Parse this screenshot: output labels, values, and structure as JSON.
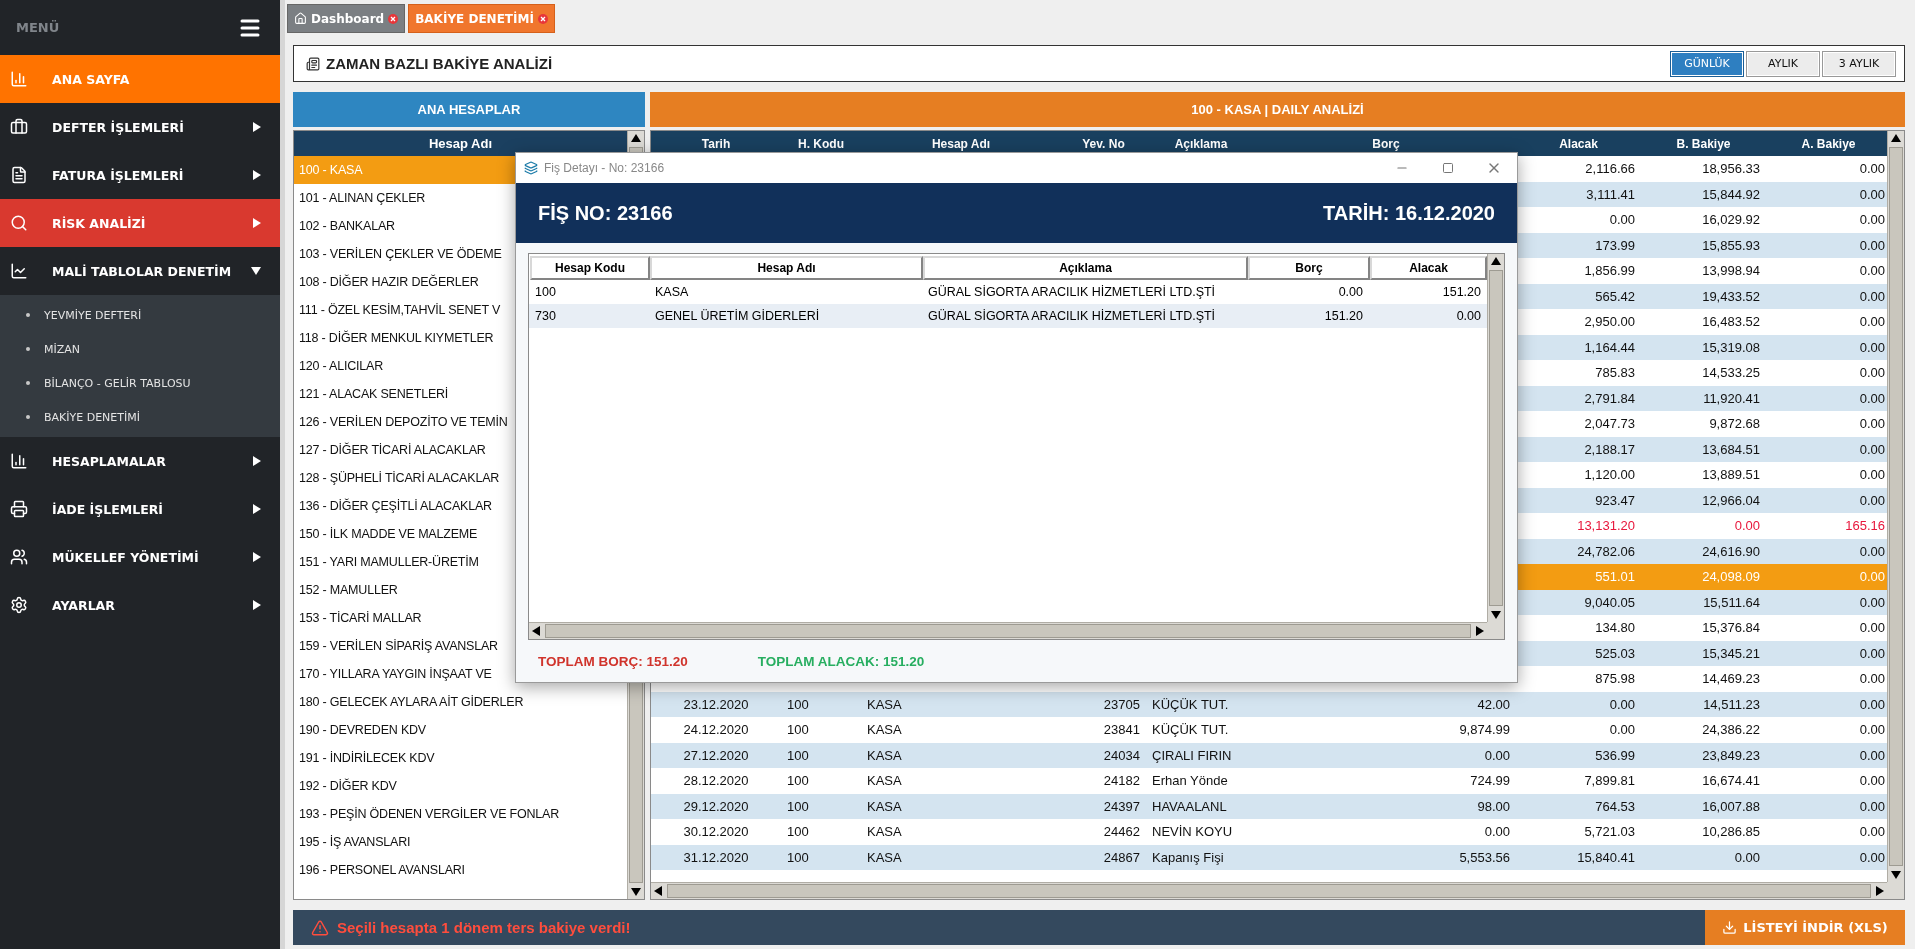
{
  "sidebar": {
    "title": "MENÜ",
    "items": [
      {
        "label": "ANA SAYFA",
        "color": "#ff7300"
      },
      {
        "label": "DEFTER İŞLEMLERİ",
        "color": "#212428",
        "expanded": false
      },
      {
        "label": "FATURA İŞLEMLERİ",
        "color": "#212428",
        "expanded": false
      },
      {
        "label": "RİSK ANALİZİ",
        "color": "#d9392f",
        "expanded": false
      },
      {
        "label": "MALİ TABLOLAR DENETİM",
        "color": "#212428",
        "expanded": true,
        "children": [
          "YEVMİYE DEFTERİ",
          "MİZAN",
          "BİLANÇO - GELİR TABLOSU",
          "BAKİYE DENETİMİ"
        ]
      },
      {
        "label": "HESAPLAMALAR",
        "color": "#212428",
        "expanded": false
      },
      {
        "label": "İADE İŞLEMLERİ",
        "color": "#212428",
        "expanded": false
      },
      {
        "label": "MÜKELLEF YÖNETİMİ",
        "color": "#212428",
        "expanded": false
      },
      {
        "label": "AYARLAR",
        "color": "#212428",
        "expanded": false
      }
    ]
  },
  "tabs": [
    {
      "label": "Dashboard",
      "selected": false
    },
    {
      "label": "BAKİYE DENETİMİ",
      "selected": true
    }
  ],
  "panel": {
    "title": "ZAMAN BAZLI BAKİYE ANALİZİ",
    "periods": [
      {
        "label": "GÜNLÜK",
        "selected": true
      },
      {
        "label": "AYLIK",
        "selected": false
      },
      {
        "label": "3 AYLIK",
        "selected": false
      }
    ]
  },
  "accounts": {
    "title": "ANA HESAPLAR",
    "column": "Hesap Adı",
    "items": [
      {
        "label": "100 - KASA",
        "selected": true
      },
      {
        "label": "101 - ALINAN ÇEKLER",
        "selected": false
      },
      {
        "label": "102 - BANKALAR",
        "selected": false
      },
      {
        "label": "103 - VERİLEN ÇEKLER VE ÖDEME",
        "selected": false
      },
      {
        "label": "108 - DİĞER HAZIR DEĞERLER",
        "selected": false
      },
      {
        "label": "111 - ÖZEL KESİM,TAHVİL SENET V",
        "selected": false
      },
      {
        "label": "118 - DİĞER MENKUL KIYMETLER",
        "selected": false
      },
      {
        "label": "120 - ALICILAR",
        "selected": false
      },
      {
        "label": "121 - ALACAK SENETLERİ",
        "selected": false
      },
      {
        "label": "126 - VERİLEN DEPOZİTO VE TEMİN",
        "selected": false
      },
      {
        "label": "127 - DİĞER TİCARİ ALACAKLAR",
        "selected": false
      },
      {
        "label": "128 - ŞÜPHELİ TİCARİ ALACAKLAR",
        "selected": false
      },
      {
        "label": "136 - DİĞER ÇEŞİTLİ ALACAKLAR",
        "selected": false
      },
      {
        "label": "150 - İLK MADDE VE MALZEME",
        "selected": false
      },
      {
        "label": "151 - YARI MAMULLER-ÜRETİM",
        "selected": false
      },
      {
        "label": "152 - MAMULLER",
        "selected": false
      },
      {
        "label": "153 - TİCARİ MALLAR",
        "selected": false
      },
      {
        "label": "159 - VERİLEN SİPARİŞ AVANSLAR",
        "selected": false
      },
      {
        "label": "170 - YILLARA YAYGIN İNŞAAT VE",
        "selected": false
      },
      {
        "label": "180 - GELECEK AYLARA AİT GİDERLER",
        "selected": false
      },
      {
        "label": "190 - DEVREDEN KDV",
        "selected": false
      },
      {
        "label": "191 - İNDİRİLECEK KDV",
        "selected": false
      },
      {
        "label": "192 - DİĞER KDV",
        "selected": false
      },
      {
        "label": "193 - PEŞİN ÖDENEN VERGİLER VE FONLAR",
        "selected": false
      },
      {
        "label": "195 - İŞ AVANSLARI",
        "selected": false
      },
      {
        "label": "196 - PERSONEL AVANSLARI",
        "selected": false
      }
    ]
  },
  "analysis": {
    "title": "100 - KASA | DAILY ANALİZİ",
    "columns": [
      "Tarih",
      "H. Kodu",
      "Hesap Adı",
      "Yev. No",
      "Açıklama",
      "Borç",
      "Alacak",
      "B. Bakiye",
      "A. Bakiye"
    ],
    "rows": [
      {
        "credit": "2,116.66",
        "debit_balance": "18,956.33",
        "credit_balance": "0.00",
        "selected": false,
        "alert": false
      },
      {
        "credit": "3,111.41",
        "debit_balance": "15,844.92",
        "credit_balance": "0.00",
        "selected": false,
        "alert": false
      },
      {
        "credit": "0.00",
        "debit_balance": "16,029.92",
        "credit_balance": "0.00",
        "selected": false,
        "alert": false
      },
      {
        "credit": "173.99",
        "debit_balance": "15,855.93",
        "credit_balance": "0.00",
        "selected": false,
        "alert": false
      },
      {
        "credit": "1,856.99",
        "debit_balance": "13,998.94",
        "credit_balance": "0.00",
        "selected": false,
        "alert": false
      },
      {
        "credit": "565.42",
        "debit_balance": "19,433.52",
        "credit_balance": "0.00",
        "selected": false,
        "alert": false
      },
      {
        "credit": "2,950.00",
        "debit_balance": "16,483.52",
        "credit_balance": "0.00",
        "selected": false,
        "alert": false
      },
      {
        "credit": "1,164.44",
        "debit_balance": "15,319.08",
        "credit_balance": "0.00",
        "selected": false,
        "alert": false
      },
      {
        "credit": "785.83",
        "debit_balance": "14,533.25",
        "credit_balance": "0.00",
        "selected": false,
        "alert": false
      },
      {
        "credit": "2,791.84",
        "debit_balance": "11,920.41",
        "credit_balance": "0.00",
        "selected": false,
        "alert": false
      },
      {
        "credit": "2,047.73",
        "debit_balance": "9,872.68",
        "credit_balance": "0.00",
        "selected": false,
        "alert": false
      },
      {
        "credit": "2,188.17",
        "debit_balance": "13,684.51",
        "credit_balance": "0.00",
        "selected": false,
        "alert": false
      },
      {
        "credit": "1,120.00",
        "debit_balance": "13,889.51",
        "credit_balance": "0.00",
        "selected": false,
        "alert": false
      },
      {
        "credit": "923.47",
        "debit_balance": "12,966.04",
        "credit_balance": "0.00",
        "selected": false,
        "alert": false
      },
      {
        "credit": "13,131.20",
        "debit_balance": "0.00",
        "credit_balance": "165.16",
        "selected": false,
        "alert": true
      },
      {
        "credit": "24,782.06",
        "debit_balance": "24,616.90",
        "credit_balance": "0.00",
        "selected": false,
        "alert": false
      },
      {
        "credit": "551.01",
        "debit_balance": "24,098.09",
        "credit_balance": "0.00",
        "selected": true,
        "alert": false
      },
      {
        "credit": "9,040.05",
        "debit_balance": "15,511.64",
        "credit_balance": "0.00",
        "selected": false,
        "alert": false
      },
      {
        "credit": "134.80",
        "debit_balance": "15,376.84",
        "credit_balance": "0.00",
        "selected": false,
        "alert": false
      },
      {
        "credit": "525.03",
        "debit_balance": "15,345.21",
        "credit_balance": "0.00",
        "selected": false,
        "alert": false
      },
      {
        "credit": "875.98",
        "debit_balance": "14,469.23",
        "credit_balance": "0.00",
        "selected": false,
        "alert": false
      },
      {
        "date": "23.12.2020",
        "code": "100",
        "account": "KASA",
        "voucher": "23705",
        "description": "KÜÇÜK TUT.",
        "debit": "42.00",
        "credit": "0.00",
        "debit_balance": "14,511.23",
        "credit_balance": "0.00",
        "selected": false,
        "alert": false
      },
      {
        "date": "24.12.2020",
        "code": "100",
        "account": "KASA",
        "voucher": "23841",
        "description": "KÜÇÜK TUT.",
        "debit": "9,874.99",
        "credit": "0.00",
        "debit_balance": "24,386.22",
        "credit_balance": "0.00",
        "selected": false,
        "alert": false
      },
      {
        "date": "27.12.2020",
        "code": "100",
        "account": "KASA",
        "voucher": "24034",
        "description": "ÇIRALI FIRIN",
        "debit": "0.00",
        "credit": "536.99",
        "debit_balance": "23,849.23",
        "credit_balance": "0.00",
        "selected": false,
        "alert": false
      },
      {
        "date": "28.12.2020",
        "code": "100",
        "account": "KASA",
        "voucher": "24182",
        "description": "Erhan Yönde",
        "debit": "724.99",
        "credit": "7,899.81",
        "debit_balance": "16,674.41",
        "credit_balance": "0.00",
        "selected": false,
        "alert": false
      },
      {
        "date": "29.12.2020",
        "code": "100",
        "account": "KASA",
        "voucher": "24397",
        "description": "HAVAALANL",
        "debit": "98.00",
        "credit": "764.53",
        "debit_balance": "16,007.88",
        "credit_balance": "0.00",
        "selected": false,
        "alert": false
      },
      {
        "date": "30.12.2020",
        "code": "100",
        "account": "KASA",
        "voucher": "24462",
        "description": "NEVİN KOYU",
        "debit": "0.00",
        "credit": "5,721.03",
        "debit_balance": "10,286.85",
        "credit_balance": "0.00",
        "selected": false,
        "alert": false
      },
      {
        "date": "31.12.2020",
        "code": "100",
        "account": "KASA",
        "voucher": "24867",
        "description": "Kapanış Fişi",
        "debit": "5,553.56",
        "credit": "15,840.41",
        "debit_balance": "0.00",
        "credit_balance": "0.00",
        "selected": false,
        "alert": false
      }
    ]
  },
  "footer": {
    "warning": "Seçili hesapta 1 dönem ters bakiye verdi!",
    "download": "LİSTEYİ İNDİR (XLS)"
  },
  "dialog": {
    "title": "Fiş Detayı - No: 23166",
    "voucher": "FİŞ NO: 23166",
    "date": "TARİH: 16.12.2020",
    "columns": [
      "Hesap Kodu",
      "Hesap Adı",
      "Açıklama",
      "Borç",
      "Alacak"
    ],
    "rows": [
      [
        "100",
        "KASA",
        "GÜRAL SİGORTA ARACILIK HİZMETLERİ LTD.ŞTİ",
        "0.00",
        "151.20"
      ],
      [
        "730",
        "GENEL ÜRETİM GİDERLERİ",
        "GÜRAL SİGORTA ARACILIK HİZMETLERİ LTD.ŞTİ",
        "151.20",
        "0.00"
      ]
    ],
    "total_debit": "TOPLAM BORÇ: 151.20",
    "total_credit": "TOPLAM ALACAK: 151.20"
  }
}
